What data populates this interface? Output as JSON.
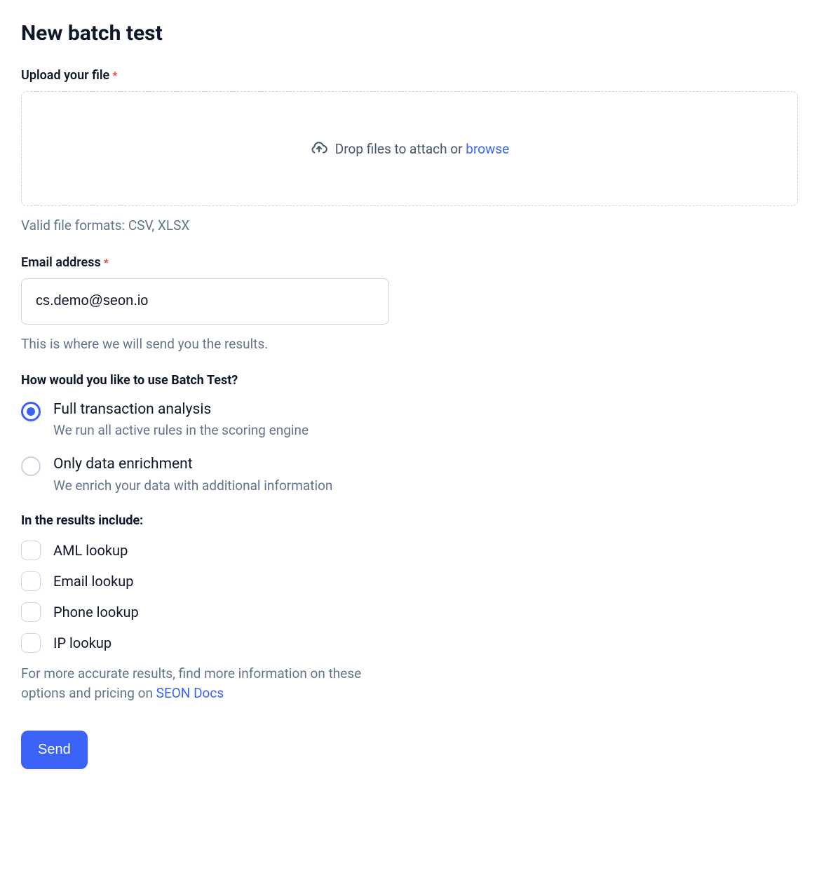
{
  "page": {
    "title": "New batch test"
  },
  "upload": {
    "label": "Upload your file",
    "drop_text": "Drop files to attach or ",
    "browse": "browse",
    "formats_help": "Valid file formats: CSV, XLSX"
  },
  "email": {
    "label": "Email address",
    "value": "cs.demo@seon.io",
    "help": "This is where we will send you the results."
  },
  "usage": {
    "label": "How would you like to use Batch Test?",
    "options": [
      {
        "title": "Full transaction analysis",
        "desc": "We run all active rules in the scoring engine",
        "selected": true
      },
      {
        "title": "Only data enrichment",
        "desc": "We enrich your data with additional information",
        "selected": false
      }
    ]
  },
  "results": {
    "label": "In the results include:",
    "options": [
      {
        "label": "AML lookup",
        "checked": false
      },
      {
        "label": "Email lookup",
        "checked": false
      },
      {
        "label": "Phone lookup",
        "checked": false
      },
      {
        "label": "IP lookup",
        "checked": false
      }
    ],
    "note_prefix": "For more accurate results, find more information on these options and pricing on ",
    "docs_link": "SEON Docs"
  },
  "actions": {
    "send": "Send"
  }
}
